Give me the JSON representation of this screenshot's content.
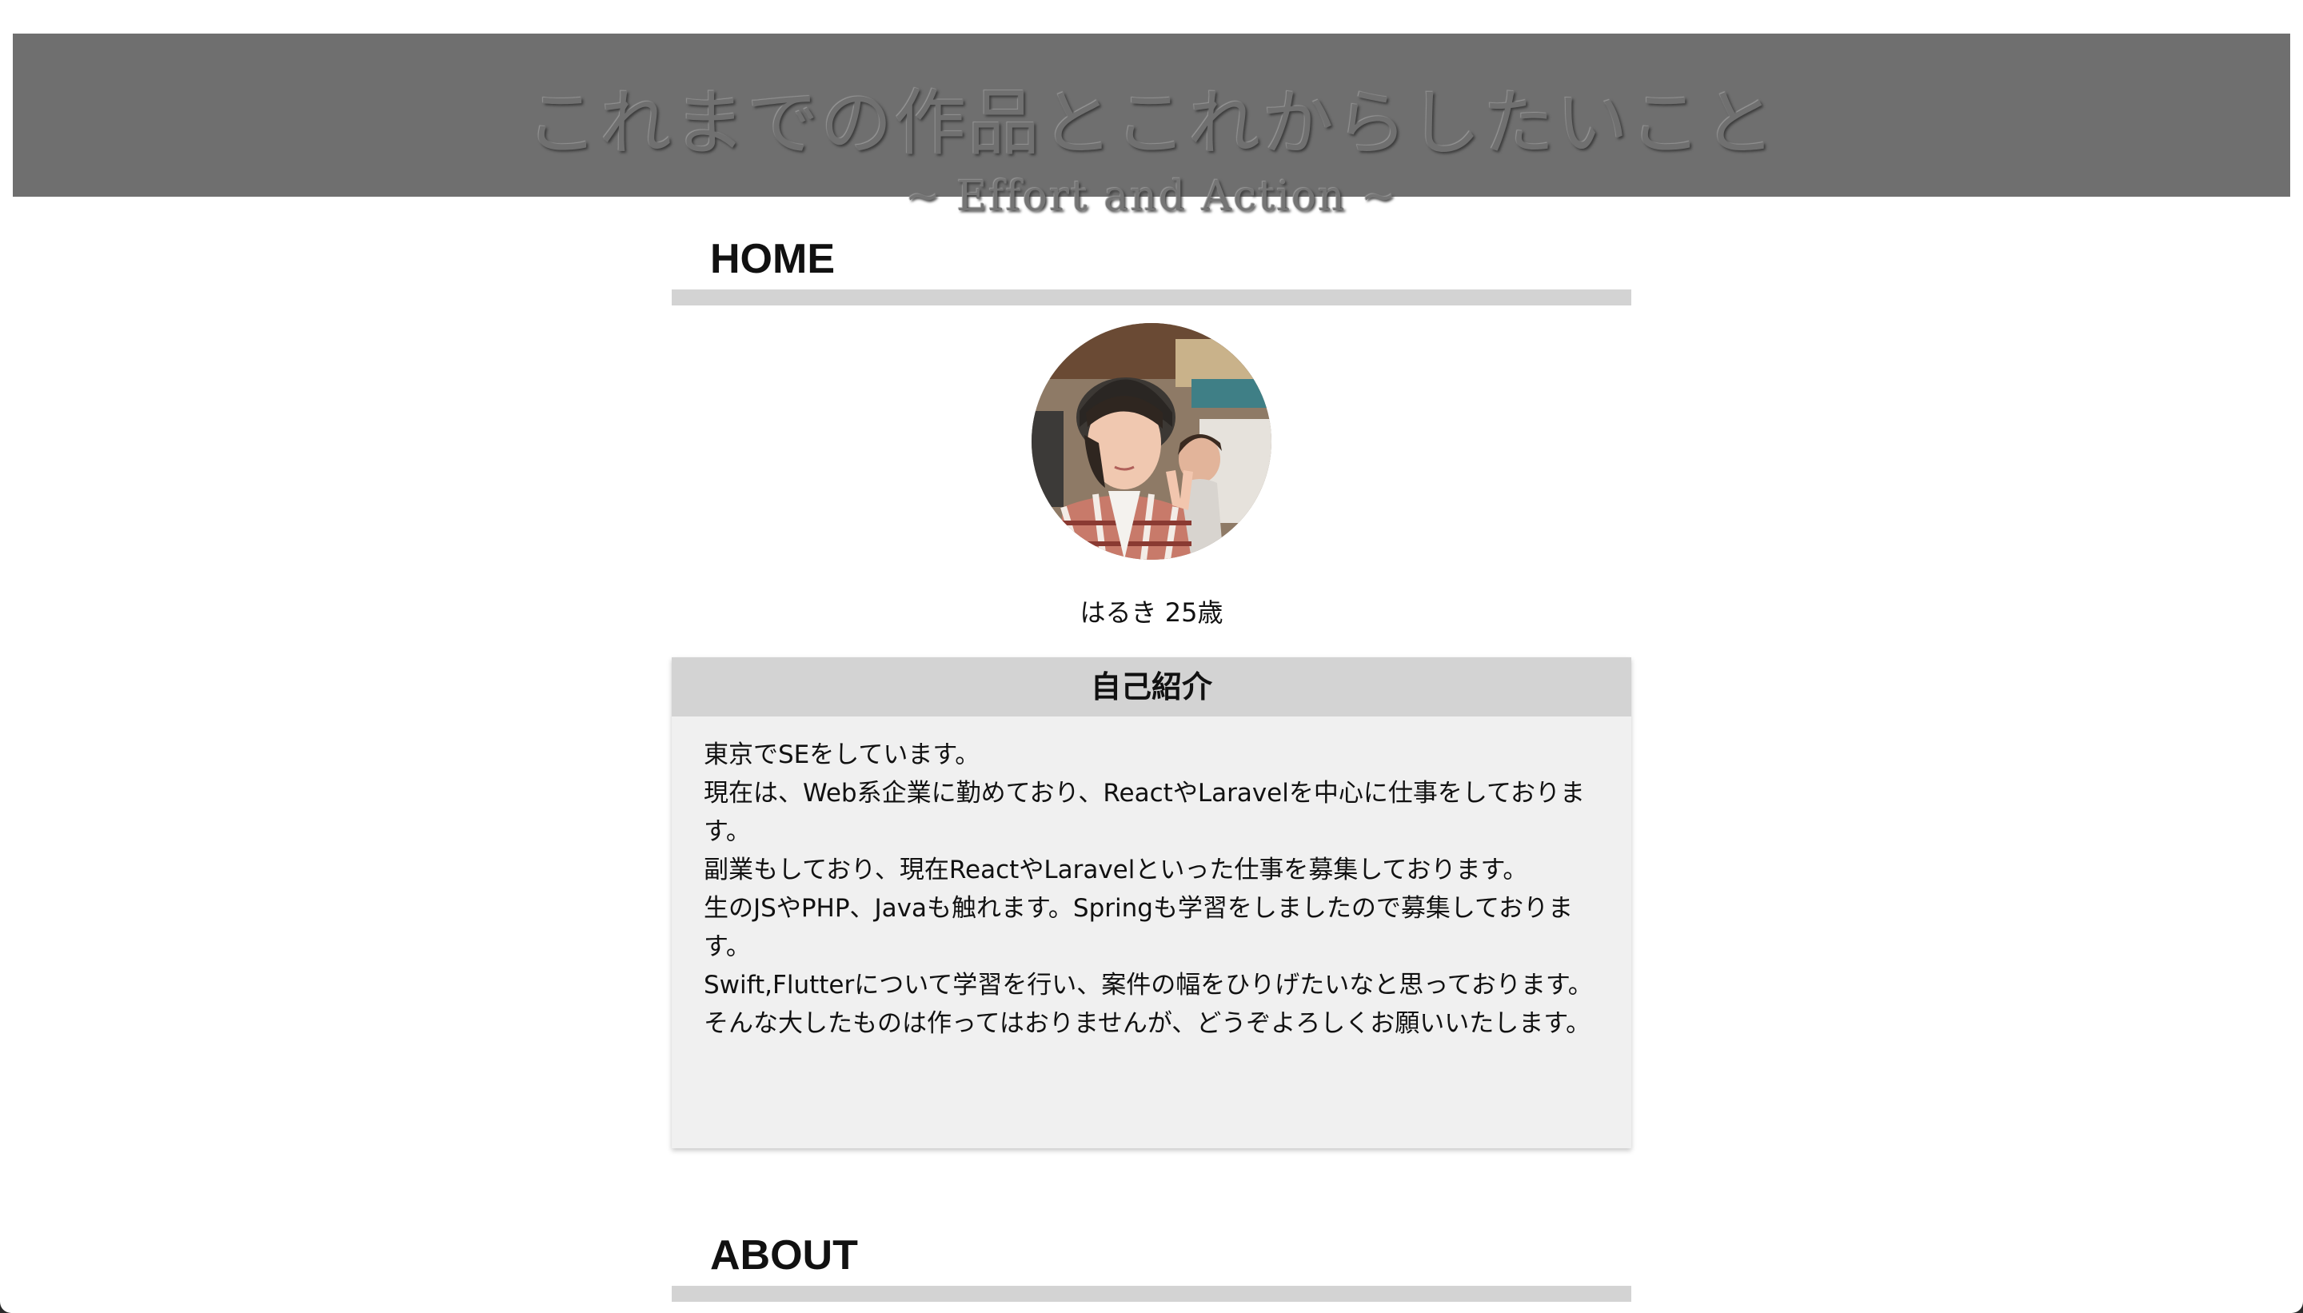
{
  "header": {
    "title": "これまでの作品とこれからしたいこと",
    "subtitle": "~ Effort and Action ~"
  },
  "sections": {
    "home": "HOME",
    "about": "ABOUT"
  },
  "profile": {
    "name_age": "はるき 25歳"
  },
  "intro": {
    "heading": "自己紹介",
    "lines": [
      "東京でSEをしています。",
      "現在は、Web系企業に勤めており、ReactやLaravelを中心に仕事をしております。",
      "副業もしており、現在ReactやLaravelといった仕事を募集しております。",
      "生のJSやPHP、Javaも触れます。Springも学習をしましたので募集しております。",
      "Swift,Flutterについて学習を行い、案件の幅をひりげたいなと思っております。",
      "そんな大したものは作ってはおりませんが、どうぞよろしくお願いいたします。"
    ]
  },
  "colors": {
    "header_bg": "#6f6f6f",
    "section_bar": "#d3d3d3",
    "intro_bg": "#f0f0f0"
  }
}
